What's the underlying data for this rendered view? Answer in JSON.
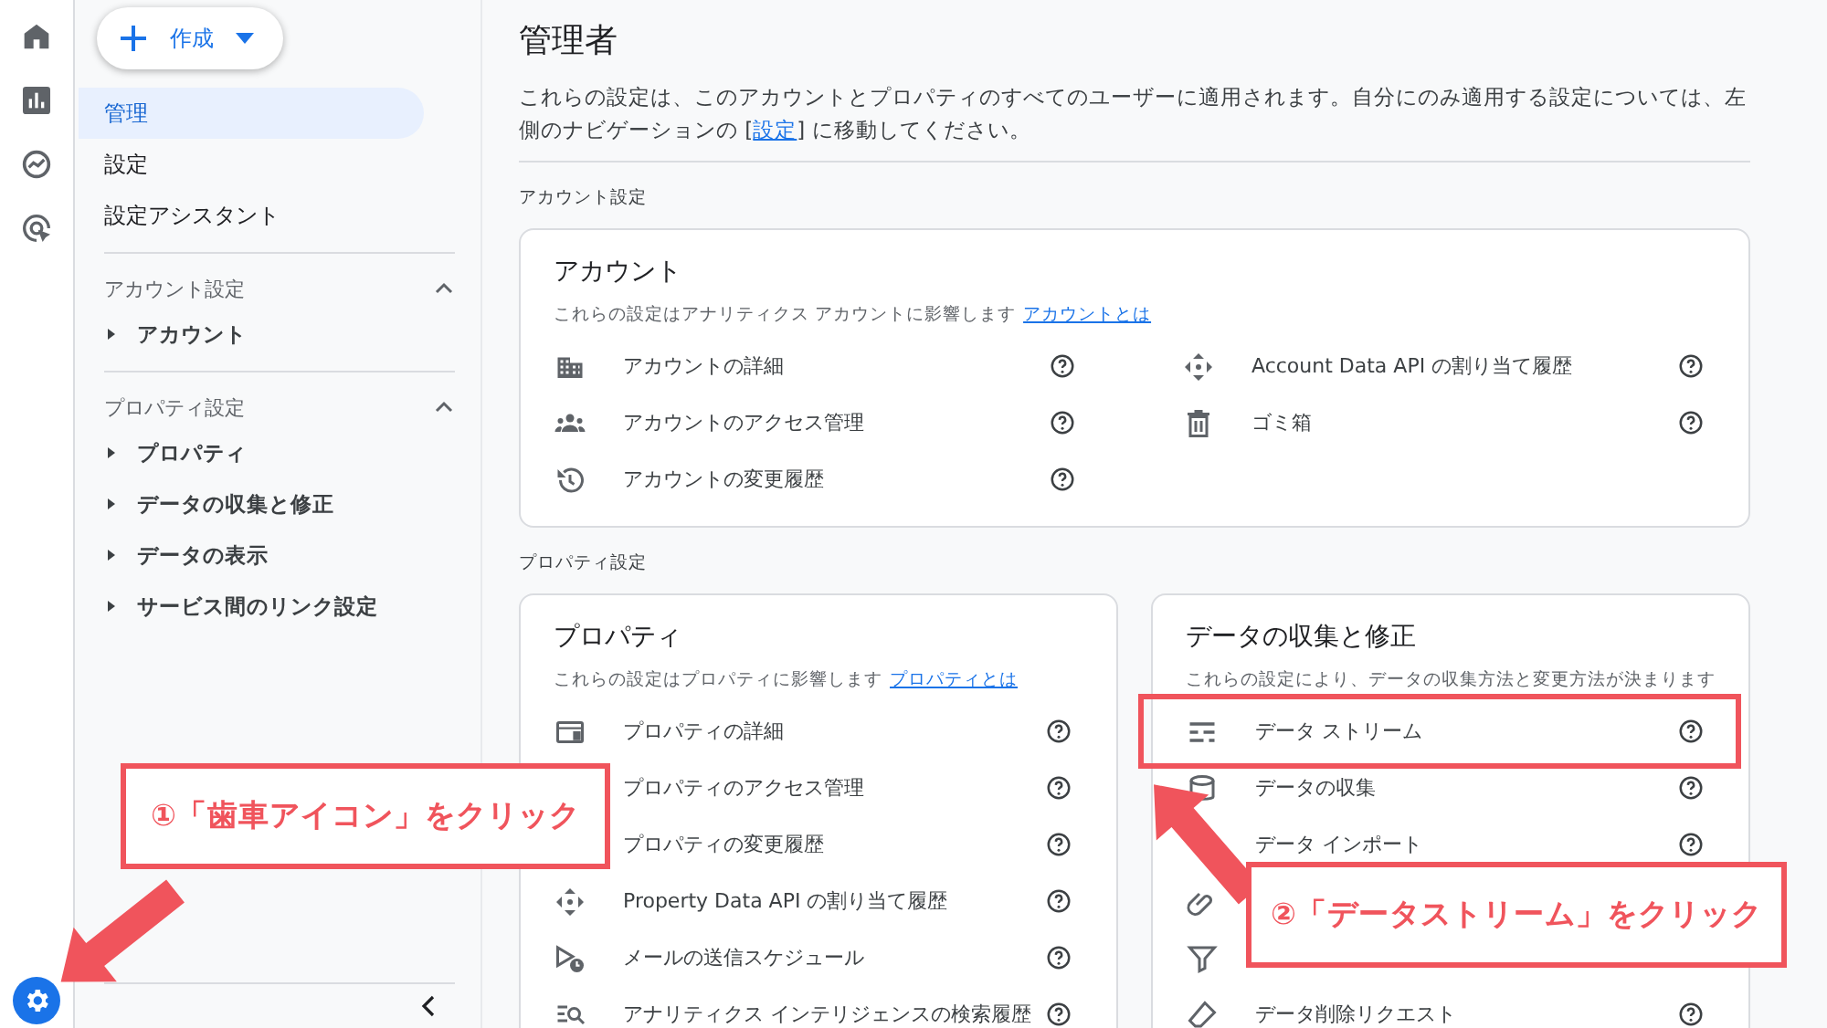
{
  "create_button": {
    "label": "作成"
  },
  "nav": [
    {
      "label": "管理",
      "selected": true
    },
    {
      "label": "設定",
      "selected": false
    },
    {
      "label": "設定アシスタント",
      "selected": false
    }
  ],
  "nav_sections": [
    {
      "title": "アカウント設定",
      "expanded": true,
      "items": [
        {
          "label": "アカウント",
          "expanded": false
        }
      ]
    },
    {
      "title": "プロパティ設定",
      "expanded": true,
      "items": [
        {
          "label": "プロパティ",
          "expanded": false
        },
        {
          "label": "データの収集と修正",
          "expanded": false
        },
        {
          "label": "データの表示",
          "expanded": false
        },
        {
          "label": "サービス間のリンク設定",
          "expanded": false
        }
      ]
    }
  ],
  "page": {
    "title": "管理者",
    "description_before": "これらの設定は、このアカウントとプロパティのすべてのユーザーに適用されます。自分にのみ適用する設定については、左側のナビゲーションの [",
    "description_link": "設定",
    "description_after": "] に移動してください。"
  },
  "account_section": {
    "label": "アカウント設定",
    "card": {
      "title": "アカウント",
      "description": "これらの設定はアナリティクス アカウントに影響します",
      "link": "アカウントとは",
      "columns": [
        [
          {
            "label": "アカウントの詳細",
            "icon_covered": false
          },
          {
            "label": "アカウントのアクセス管理",
            "icon_covered": false
          },
          {
            "label": "アカウントの変更履歴",
            "icon_covered": false
          }
        ],
        [
          {
            "label": "Account Data API の割り当て履歴",
            "icon_covered": false
          },
          {
            "label": "ゴミ箱",
            "icon_covered": false
          }
        ]
      ]
    }
  },
  "property_section": {
    "label": "プロパティ設定",
    "cards": [
      {
        "title": "プロパティ",
        "description": "これらの設定はプロパティに影響します",
        "link": "プロパティとは",
        "items": [
          {
            "kind": "item",
            "label": "プロパティの詳細",
            "icon_covered": false
          },
          {
            "kind": "item",
            "label": "プロパティのアクセス管理"
          },
          {
            "kind": "item",
            "label": "プロパティの変更履歴"
          },
          {
            "kind": "item",
            "label": "Property Data API の割り当て履歴",
            "icon_covered": false
          },
          {
            "kind": "item",
            "label": "メールの送信スケジュール",
            "icon_covered": false
          },
          {
            "kind": "item",
            "label": "アナリティクス インテリジェンスの検索履歴",
            "icon_covered": false
          }
        ]
      },
      {
        "title": "データの収集と修正",
        "description": "これらの設定により、データの収集方法と変更方法が決まります",
        "items": [
          {
            "kind": "item",
            "label": "データ ストリーム",
            "icon_covered": false
          },
          {
            "kind": "item",
            "label": "データの収集",
            "icon_covered": false
          },
          {
            "kind": "item",
            "label": "データ インポート",
            "icon_covered": true
          },
          {
            "kind": "covered",
            "icon_covered": false
          },
          {
            "kind": "covered",
            "icon_covered": false
          },
          {
            "kind": "item",
            "label": "データ削除リクエスト",
            "icon_covered": false
          }
        ]
      }
    ]
  },
  "annotations": [
    {
      "text": "①「歯車アイコン」をクリック"
    },
    {
      "text": "②「データストリーム」をクリック"
    }
  ]
}
